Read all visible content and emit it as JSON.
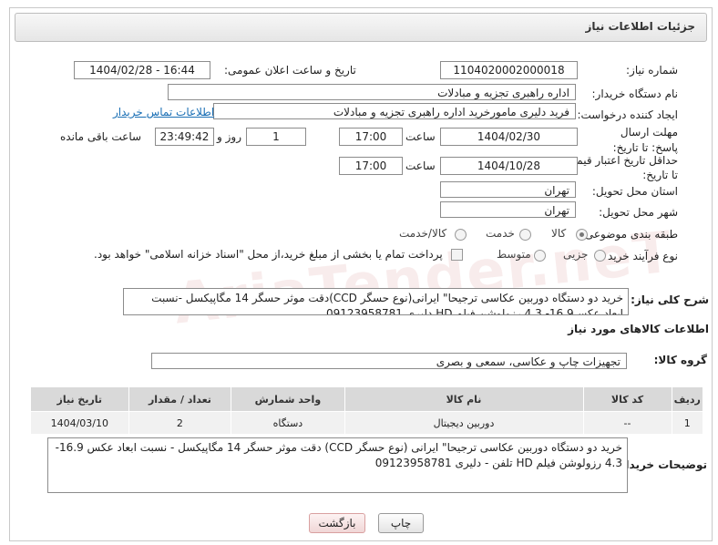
{
  "header": {
    "title": "جزئیات اطلاعات نیاز"
  },
  "fields": {
    "need_number_label": "شماره نیاز:",
    "need_number": "1104020002000018",
    "announce_label": "تاریخ و ساعت اعلان عمومی:",
    "announce_value": "1404/02/28 - 16:44",
    "buyer_org_label": "نام دستگاه خریدار:",
    "buyer_org": "اداره راهبری تجزیه و مبادلات",
    "creator_label": "ایجاد کننده درخواست:",
    "creator": "فرید دلیری مامورخرید اداره راهبری تجزیه و مبادلات",
    "buyer_contact_link": "اطلاعات تماس خریدار",
    "deadline_label": "مهلت ارسال پاسخ: تا تاریخ:",
    "deadline_date": "1404/02/30",
    "time_label": "ساعت",
    "deadline_time": "17:00",
    "days_value": "1",
    "days_label": "روز و",
    "remaining_time": "23:49:42",
    "remaining_label": "ساعت باقی مانده",
    "validity_label": "حداقل تاریخ اعتبار قیمت: تا تاریخ:",
    "validity_date": "1404/10/28",
    "validity_time": "17:00",
    "province_label": "استان محل تحویل:",
    "province": "تهران",
    "city_label": "شهر محل تحویل:",
    "city": "تهران",
    "category_label": "طبقه بندی موضوعی:",
    "category_options": [
      "کالا",
      "خدمت",
      "کالا/خدمت"
    ],
    "process_label": "نوع فرآیند خرید :",
    "process_options": [
      "جزیی",
      "متوسط"
    ],
    "payment_note": "پرداخت تمام یا بخشی از مبلغ خرید،از محل \"اسناد خزانه اسلامی\" خواهد بود."
  },
  "summary": {
    "label": "شرح کلی نیاز:",
    "text": "خرید دو دستگاه دوربین عکاسی ترجیحا\" ایرانی(نوع حسگر CCD)دقت موثر حسگر 14 مگاپیکسل -نسبت ابعاد عکس16.9- 4.3 رزولوشن فیلم HD دلیری 09123958781"
  },
  "goods_section": {
    "title": "اطلاعات کالاهای مورد نیاز",
    "group_label": "گروه کالا:",
    "group_value": "تجهیزات چاپ و عکاسی، سمعی و بصری"
  },
  "table": {
    "headers": [
      "ردیف",
      "کد کالا",
      "نام کالا",
      "واحد شمارش",
      "تعداد / مقدار",
      "تاریخ نیاز"
    ],
    "rows": [
      [
        "1",
        "--",
        "دوربین دیجیتال",
        "دستگاه",
        "2",
        "1404/03/10"
      ]
    ]
  },
  "buyer_desc": {
    "label": "توضیحات خریدار:",
    "text": "خرید دو دستگاه دوربین عکاسی ترجیحا\" ایرانی (نوع حسگر CCD) دقت موثر حسگر 14 مگاپیکسل - نسبت ابعاد عکس 16.9- 4.3 رزولوشن فیلم HD تلفن - دلیری 09123958781"
  },
  "buttons": {
    "print": "چاپ",
    "back": "بازگشت"
  },
  "watermark": "AriaTender.neT"
}
